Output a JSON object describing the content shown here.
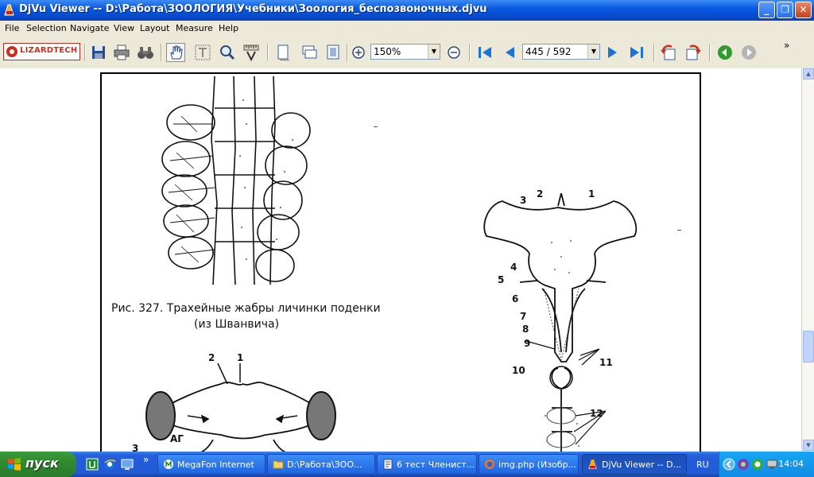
{
  "window": {
    "title": "DjVu Viewer -- D:\\Работа\\ЗООЛОГИЯ\\Учебники\\Зоология_беспозвоночных.djvu"
  },
  "menu": [
    "File",
    "Selection",
    "Navigate",
    "View",
    "Layout",
    "Measure",
    "Help"
  ],
  "toolbar": {
    "logo": "LIZARDTECH",
    "zoom": "150%",
    "page": "445 / 592",
    "overflow": "»"
  },
  "document": {
    "caption_line1": "Рис. 327. Трахейные жабры личинки поденки",
    "caption_line2": "(из Шванвича)",
    "fig_left_labels": [
      "2",
      "1",
      "АГ",
      "3"
    ],
    "fig_right_labels": [
      "3",
      "2",
      "1",
      "4",
      "5",
      "6",
      "7",
      "8",
      "9",
      "10",
      "11",
      "12"
    ]
  },
  "taskbar": {
    "start": "пуск",
    "overflow": "»",
    "tasks": [
      {
        "label": "MegaFon Internet",
        "icon": "megafon-icon"
      },
      {
        "label": "D:\\Работа\\ЗОО...",
        "icon": "folder-icon"
      },
      {
        "label": "6 тест Членист...",
        "icon": "word-icon"
      },
      {
        "label": "img.php (Изобр...",
        "icon": "firefox-icon"
      },
      {
        "label": "DjVu Viewer -- D...",
        "icon": "djvu-icon"
      }
    ],
    "language": "RU",
    "clock": "14:04"
  }
}
